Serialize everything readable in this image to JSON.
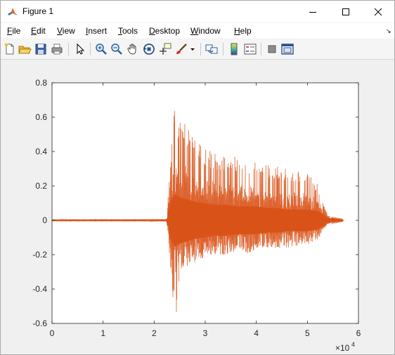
{
  "window": {
    "title": "Figure 1"
  },
  "menu": [
    "File",
    "Edit",
    "View",
    "Insert",
    "Tools",
    "Desktop",
    "Window",
    "Help"
  ],
  "toolbar_tools": [
    "new-figure",
    "open-file",
    "save-figure",
    "print-figure",
    "edit-plot",
    "zoom-in",
    "zoom-out",
    "pan",
    "rotate-3d",
    "data-cursor",
    "brush",
    "link-plot",
    "insert-colorbar",
    "insert-legend",
    "hide-plot-tools",
    "show-plot-tools"
  ],
  "chart_data": {
    "type": "line",
    "title": "",
    "xlabel": "",
    "ylabel": "",
    "x_exponent_label": "×10",
    "x_exponent": "4",
    "xlim": [
      0,
      6
    ],
    "ylim": [
      -0.6,
      0.8
    ],
    "xticks": [
      "0",
      "1",
      "2",
      "3",
      "4",
      "5",
      "6"
    ],
    "yticks": [
      "-0.6",
      "-0.4",
      "-0.2",
      "0",
      "0.2",
      "0.4",
      "0.6",
      "0.8"
    ],
    "line_color": "#d95319",
    "series": [
      {
        "x": [
          0,
          2.25,
          2.3,
          2.35,
          2.4,
          2.45,
          2.5,
          2.6,
          2.7,
          2.8,
          3.0,
          3.2,
          3.4,
          3.6,
          3.8,
          4.0,
          4.2,
          4.4,
          4.6,
          4.8,
          5.0,
          5.2,
          5.3,
          5.4,
          5.5,
          5.6,
          5.7
        ],
        "upper": [
          0.003,
          0.005,
          0.3,
          0.52,
          0.65,
          0.64,
          0.62,
          0.57,
          0.53,
          0.48,
          0.42,
          0.39,
          0.38,
          0.37,
          0.33,
          0.34,
          0.32,
          0.32,
          0.3,
          0.3,
          0.28,
          0.21,
          0.11,
          0.03,
          0.015,
          0.01,
          0.005
        ],
        "lower": [
          -0.003,
          -0.005,
          -0.2,
          -0.4,
          -0.58,
          -0.52,
          -0.3,
          -0.3,
          -0.25,
          -0.25,
          -0.22,
          -0.2,
          -0.2,
          -0.18,
          -0.2,
          -0.17,
          -0.17,
          -0.16,
          -0.16,
          -0.15,
          -0.14,
          -0.12,
          -0.06,
          -0.02,
          -0.015,
          -0.01,
          -0.005
        ],
        "core": [
          0.001,
          0.002,
          0.1,
          0.14,
          0.17,
          0.16,
          0.15,
          0.14,
          0.13,
          0.12,
          0.11,
          0.1,
          0.1,
          0.09,
          0.09,
          0.09,
          0.08,
          0.08,
          0.07,
          0.07,
          0.07,
          0.06,
          0.04,
          0.015,
          0.008,
          0.006,
          0.003
        ]
      }
    ]
  }
}
